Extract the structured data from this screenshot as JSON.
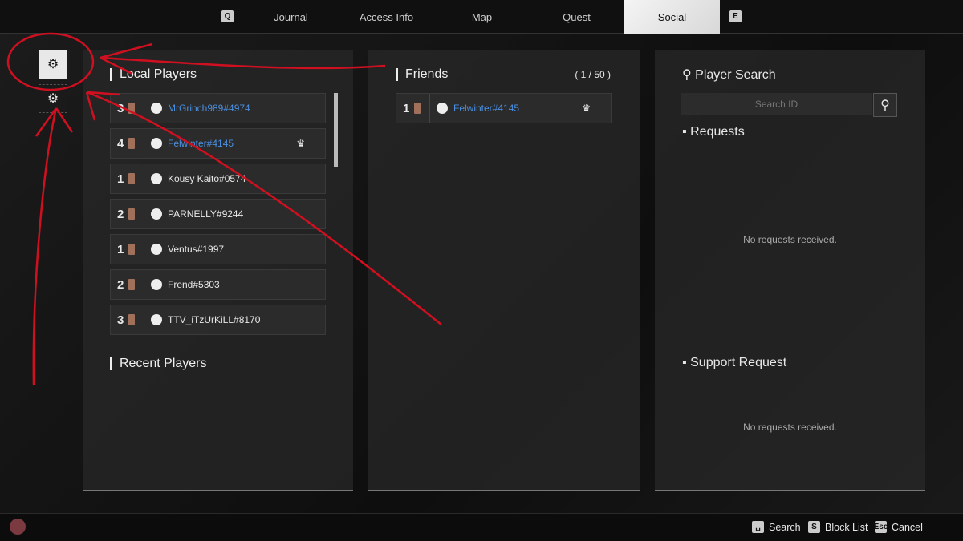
{
  "tabs": {
    "prev_key": "Q",
    "next_key": "E",
    "items": [
      {
        "label": "Journal"
      },
      {
        "label": "Access Info"
      },
      {
        "label": "Map"
      },
      {
        "label": "Quest"
      },
      {
        "label": "Social",
        "active": true
      }
    ]
  },
  "side_icons": [
    "chip-link-icon",
    "chip-user-icon"
  ],
  "local_players": {
    "title": "Local Players",
    "rows": [
      {
        "level": "3",
        "name": "MrGrinch989#4974",
        "highlight": true,
        "crown": false
      },
      {
        "level": "4",
        "name": "Felwinter#4145",
        "highlight": true,
        "crown": true
      },
      {
        "level": "1",
        "name": "Kousy Kaito#0574",
        "highlight": false,
        "crown": false
      },
      {
        "level": "2",
        "name": "PARNELLY#9244",
        "highlight": false,
        "crown": false
      },
      {
        "level": "1",
        "name": "Ventus#1997",
        "highlight": false,
        "crown": false
      },
      {
        "level": "2",
        "name": "Frend#5303",
        "highlight": false,
        "crown": false
      },
      {
        "level": "3",
        "name": "TTV_iTzUrKiLL#8170",
        "highlight": false,
        "crown": false
      }
    ]
  },
  "recent_players": {
    "title": "Recent Players"
  },
  "friends": {
    "title": "Friends",
    "count": "( 1 / 50 )",
    "rows": [
      {
        "level": "1",
        "name": "Felwinter#4145",
        "highlight": true,
        "crown": true
      }
    ]
  },
  "player_search": {
    "title": "Player Search",
    "placeholder": "Search ID"
  },
  "requests": {
    "title": "Requests",
    "empty": "No requests received."
  },
  "support": {
    "title": "Support Request",
    "empty": "No requests received."
  },
  "footer": {
    "hints": [
      {
        "key": "␣",
        "label": "Search"
      },
      {
        "key": "S",
        "label": "Block List"
      },
      {
        "key": "Esc",
        "label": "Cancel"
      }
    ]
  },
  "colors": {
    "link": "#4a8fe0",
    "annotation": "#d01020"
  }
}
